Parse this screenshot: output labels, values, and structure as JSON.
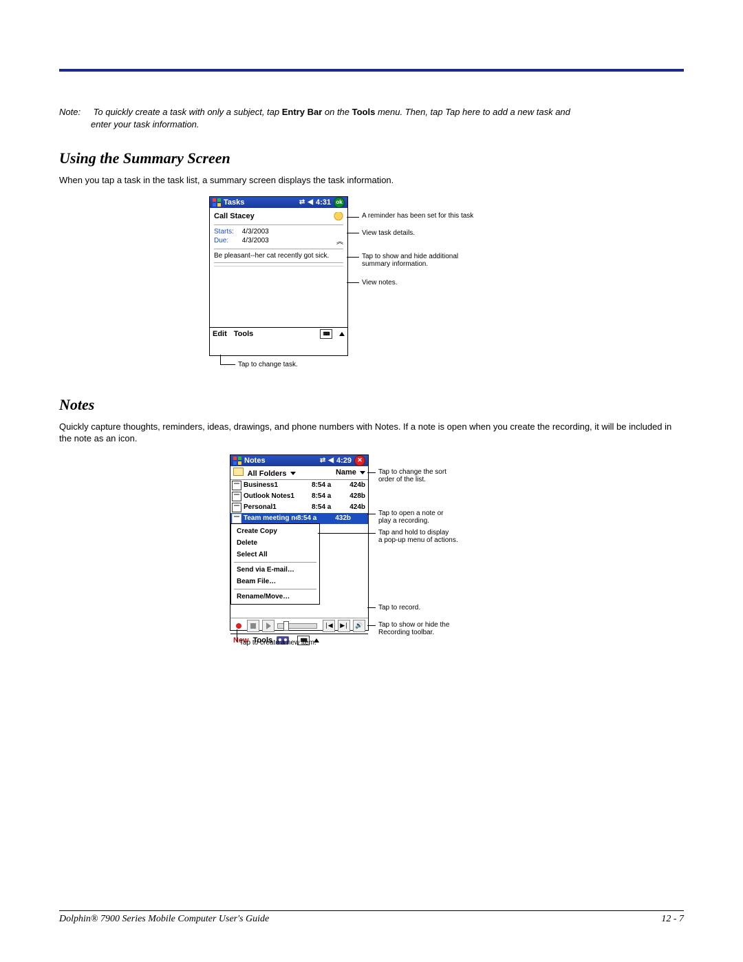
{
  "note": {
    "label": "Note:",
    "text_part1": "To quickly create a task with only a subject, tap ",
    "bold1": "Entry Bar",
    "text_part2": " on the ",
    "bold2": "Tools",
    "text_part3": " menu. Then, tap Tap here to add a new task and enter your task information."
  },
  "section1": {
    "heading": "Using the Summary Screen",
    "intro": "When you tap a task in the task list, a summary screen displays the task information."
  },
  "tasks_screen": {
    "title": "Tasks",
    "time": "4:31",
    "ok": "ok",
    "subject": "Call Stacey",
    "starts_label": "Starts:",
    "starts_value": "4/3/2003",
    "due_label": "Due:",
    "due_value": "4/3/2003",
    "note_line": "Be pleasant--her cat recently got sick.",
    "menu_edit": "Edit",
    "menu_tools": "Tools",
    "callouts": {
      "reminder": "A reminder has been set for this task",
      "view_details": "View task details.",
      "toggle": "Tap to show and hide additional summary information.",
      "view_notes": "View notes.",
      "edit_change": "Tap to change task."
    }
  },
  "section2": {
    "heading": "Notes",
    "intro": "Quickly capture thoughts, reminders, ideas, drawings, and phone numbers with Notes. If a note is open when you create the recording, it will be included in the note as an icon."
  },
  "notes_screen": {
    "title": "Notes",
    "time": "4:29",
    "folder_label": "All Folders",
    "sort_label": "Name",
    "rows": [
      {
        "name": "Business1",
        "time": "8:54 a",
        "size": "424b"
      },
      {
        "name": "Outlook Notes1",
        "time": "8:54 a",
        "size": "428b"
      },
      {
        "name": "Personal1",
        "time": "8:54 a",
        "size": "424b"
      },
      {
        "name": "Team meeting no...",
        "time": "8:54 a",
        "size": "432b"
      }
    ],
    "context_menu": [
      "Create Copy",
      "Delete",
      "Select All",
      "Send via E-mail…",
      "Beam File…",
      "Rename/Move…"
    ],
    "menu_new": "New",
    "menu_tools": "Tools",
    "callouts": {
      "sort": "Tap to change the sort order of the list.",
      "open": "Tap to open a note or play a recording.",
      "popup": "Tap and hold to display a pop-up menu of actions.",
      "record": "Tap to record.",
      "toolbar": "Tap to show or hide the Recording toolbar.",
      "new_item": "Tap to create a new item."
    }
  },
  "footer": {
    "left": "Dolphin® 7900 Series Mobile Computer User's Guide",
    "right": "12 - 7"
  }
}
